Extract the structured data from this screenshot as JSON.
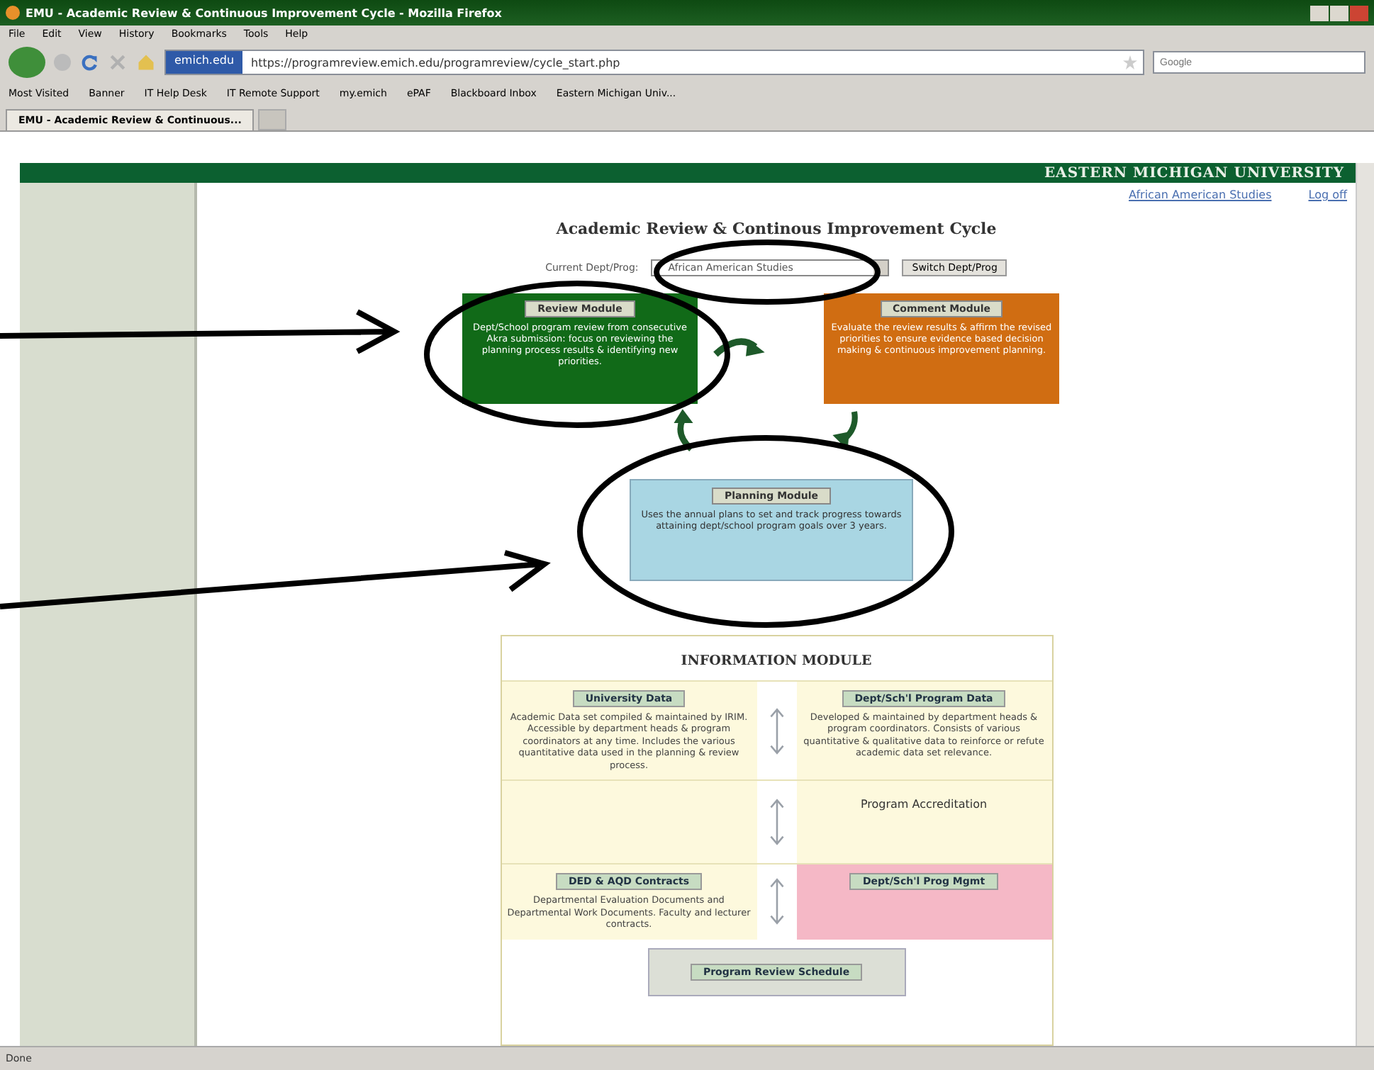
{
  "window": {
    "title": "EMU - Academic Review & Continuous Improvement Cycle - Mozilla Firefox"
  },
  "menu": [
    "File",
    "Edit",
    "View",
    "History",
    "Bookmarks",
    "Tools",
    "Help"
  ],
  "address_bar": {
    "site": "emich.edu",
    "url": "https://programreview.emich.edu/programreview/cycle_start.php"
  },
  "search": {
    "placeholder": "Google"
  },
  "bookmarks": [
    "Most Visited",
    "Banner",
    "IT Help Desk",
    "IT Remote Support",
    "my.emich",
    "ePAF",
    "Blackboard Inbox",
    "Eastern Michigan Univ..."
  ],
  "tabs": [
    {
      "label": "EMU - Academic Review & Continuous...",
      "selected": true
    }
  ],
  "banner": "EASTERN MICHIGAN UNIVERSITY",
  "user_links": [
    "African American Studies",
    "Log off"
  ],
  "page_title": "Academic Review & Continous Improvement Cycle",
  "dept_selector": {
    "label": "Current Dept/Prog:",
    "value": "African American Studies",
    "button": "Switch Dept/Prog"
  },
  "modules": [
    {
      "kind": "review",
      "button": "Review Module",
      "text": "Dept/School program review from consecutive Akra submission: focus on reviewing the planning process results & identifying new priorities."
    },
    {
      "kind": "comment",
      "button": "Comment Module",
      "text": "Evaluate the review results & affirm the revised priorities to ensure evidence based decision making & continuous improvement planning."
    },
    {
      "kind": "planning",
      "button": "Planning Module",
      "text": "Uses the annual plans to set and track progress towards attaining dept/school program goals over 3 years."
    }
  ],
  "information_module": {
    "title": "INFORMATION MODULE",
    "cells": [
      {
        "kind": "data",
        "button": "University Data",
        "text": "Academic Data set compiled & maintained by IRIM. Accessible by department heads & program coordinators at any time. Includes the various quantitative data used in the planning & review process."
      },
      {
        "kind": "data",
        "button": "Dept/Sch'l Program Data",
        "text": "Developed & maintained by department heads & program coordinators. Consists of various quantitative & qualitative data to reinforce or refute academic data set relevance."
      },
      {
        "kind": "empty"
      },
      {
        "kind": "label",
        "text": "Program Accreditation"
      },
      {
        "kind": "data",
        "button": "DED & AQD Contracts",
        "text": "Departmental Evaluation Documents and Departmental Work Documents. Faculty and lecturer contracts."
      },
      {
        "kind": "pink",
        "button": "Dept/Sch'l Prog Mgmt"
      }
    ],
    "schedule_button": "Program Review Schedule"
  },
  "status_bar": "Done"
}
